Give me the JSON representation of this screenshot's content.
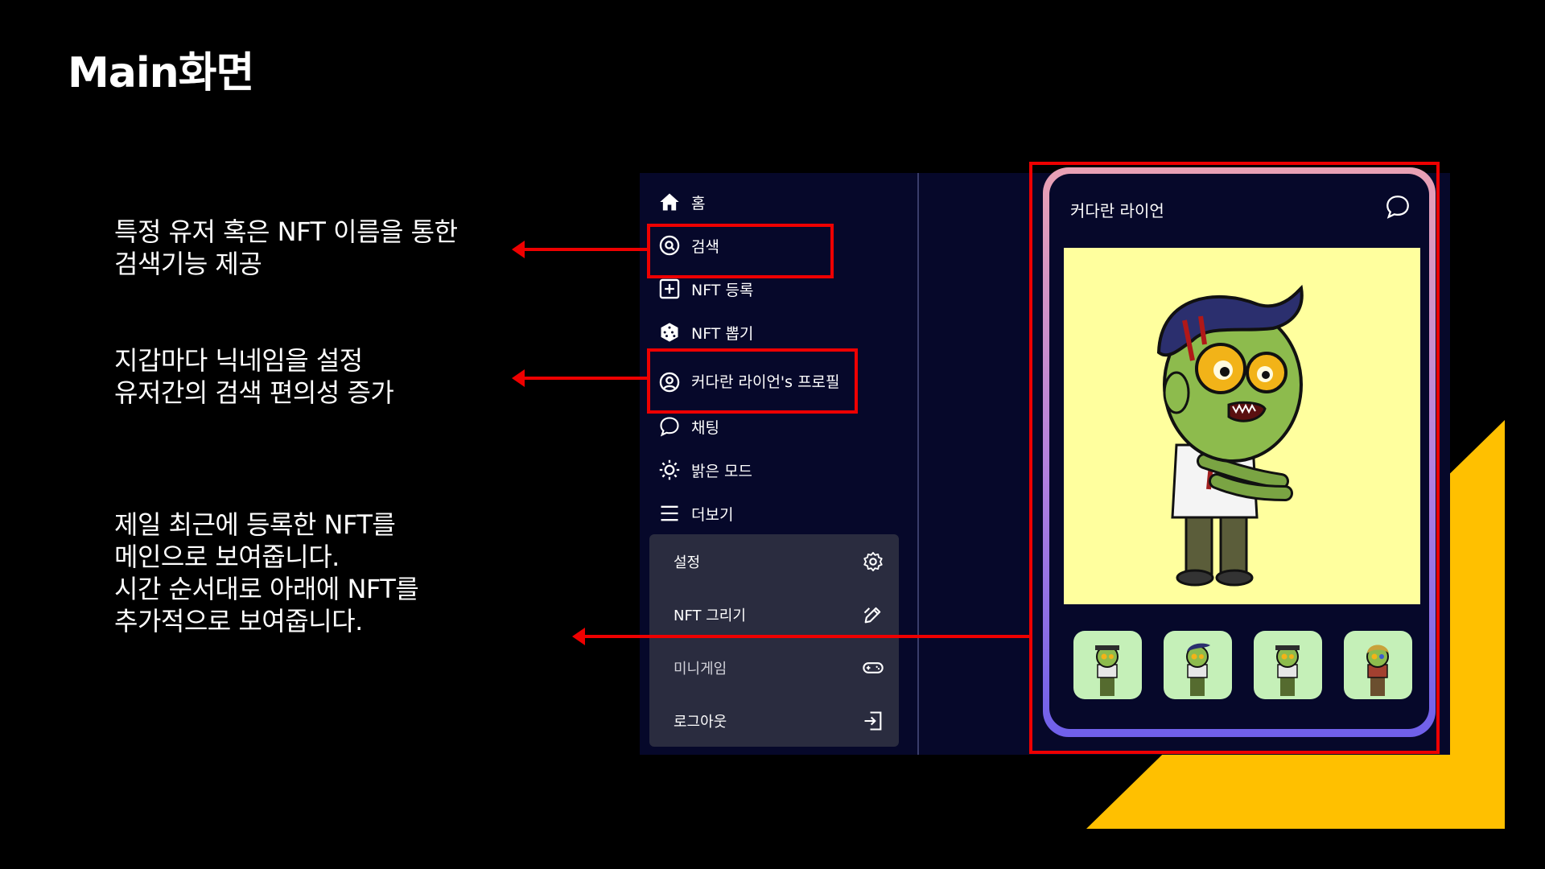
{
  "slide": {
    "title": "Main화면"
  },
  "annotations": [
    "특정 유저 혹은 NFT 이름을 통한\n검색기능 제공",
    "지갑마다 닉네임을 설정\n유저간의 검색 편의성 증가",
    "제일 최근에 등록한 NFT를\n메인으로 보여줍니다.\n시간 순서대로 아래에 NFT를\n추가적으로 보여줍니다."
  ],
  "sidebar": {
    "items": [
      {
        "label": "홈",
        "icon": "home-icon"
      },
      {
        "label": "검색",
        "icon": "search-icon"
      },
      {
        "label": "NFT 등록",
        "icon": "plus-square-icon"
      },
      {
        "label": "NFT 뽑기",
        "icon": "dice-icon"
      },
      {
        "label": "커다란 라이언's 프로필",
        "icon": "user-circle-icon"
      },
      {
        "label": "채팅",
        "icon": "chat-icon"
      },
      {
        "label": "밝은 모드",
        "icon": "sun-icon"
      },
      {
        "label": "더보기",
        "icon": "menu-icon"
      }
    ],
    "more_menu": [
      {
        "label": "설정",
        "icon": "gear-icon"
      },
      {
        "label": "NFT 그리기",
        "icon": "pen-icon"
      },
      {
        "label": "미니게임",
        "icon": "gamepad-icon"
      },
      {
        "label": "로그아웃",
        "icon": "logout-icon"
      }
    ]
  },
  "card": {
    "owner_name": "커다란 라이언",
    "chat_icon": "chat-icon",
    "main_image": "zombie-character",
    "thumbnails": [
      "zombie-cap",
      "zombie-blue-hair",
      "zombie-cap-2",
      "zombie-blonde"
    ]
  },
  "colors": {
    "highlight": "#ee0000",
    "accent_yellow": "#ffc000",
    "app_bg": "#06082a",
    "art_bg": "#ffff9e"
  }
}
